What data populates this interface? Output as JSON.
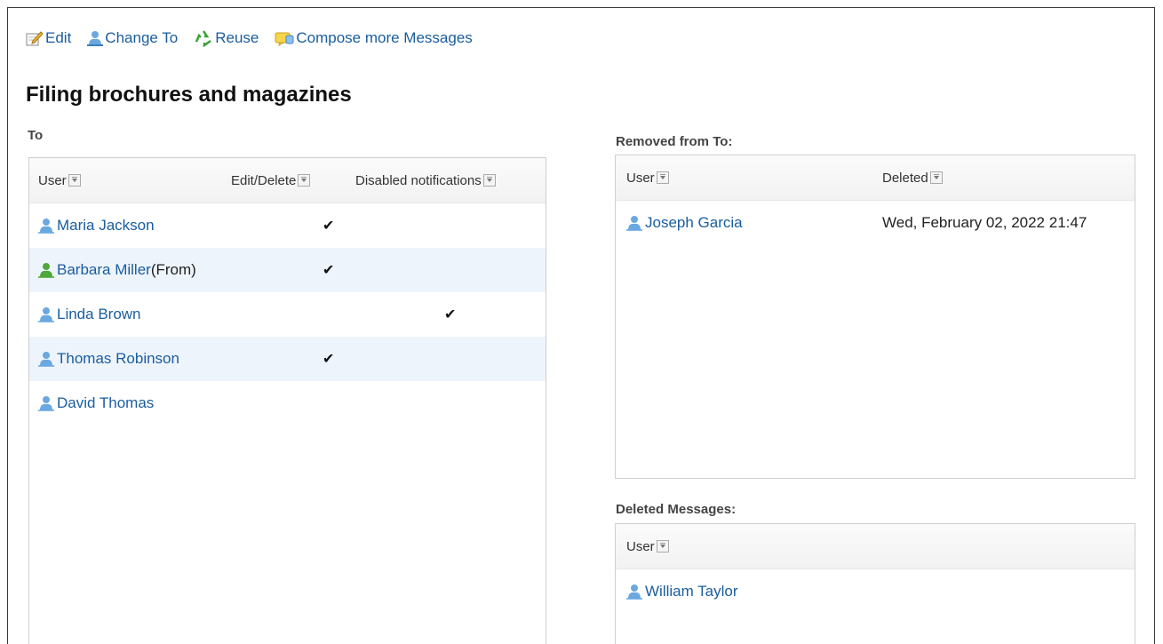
{
  "toolbar": {
    "edit": "Edit",
    "change_to": "Change To",
    "reuse": "Reuse",
    "compose": "Compose more Messages"
  },
  "title": "Filing brochures and magazines",
  "to_section": {
    "label": "To",
    "headers": {
      "user": "User",
      "edit_delete": "Edit/Delete",
      "disabled": "Disabled notifications"
    },
    "rows": [
      {
        "name": "Maria Jackson",
        "suffix": "",
        "edit_delete": "✔",
        "disabled": ""
      },
      {
        "name": "Barbara Miller",
        "suffix": "(From)",
        "edit_delete": "✔",
        "disabled": ""
      },
      {
        "name": "Linda Brown",
        "suffix": "",
        "edit_delete": "",
        "disabled": "✔"
      },
      {
        "name": "Thomas Robinson",
        "suffix": "",
        "edit_delete": "✔",
        "disabled": ""
      },
      {
        "name": "David Thomas",
        "suffix": "",
        "edit_delete": "",
        "disabled": ""
      }
    ]
  },
  "removed_section": {
    "label": "Removed from To:",
    "headers": {
      "user": "User",
      "deleted": "Deleted"
    },
    "rows": [
      {
        "name": "Joseph Garcia",
        "deleted": "Wed, February 02, 2022 21:47"
      }
    ]
  },
  "deleted_section": {
    "label": "Deleted Messages:",
    "headers": {
      "user": "User"
    },
    "rows": [
      {
        "name": "William Taylor"
      }
    ]
  },
  "colors": {
    "link": "#1a5d9e",
    "alt_row": "#eef4fb",
    "user_icon": "#6aa8e0",
    "sender_icon": "#4fa83a"
  }
}
